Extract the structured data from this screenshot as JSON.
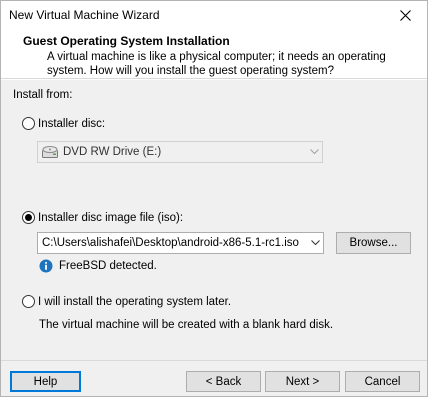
{
  "window": {
    "title": "New Virtual Machine Wizard"
  },
  "header": {
    "title": "Guest Operating System Installation",
    "description": "A virtual machine is like a physical computer; it needs an operating system. How will you install the guest operating system?"
  },
  "install_from": {
    "label": "Install from:",
    "options": {
      "disc": {
        "label": "Installer disc:",
        "checked": false,
        "drive": "DVD RW Drive (E:)"
      },
      "iso": {
        "label": "Installer disc image file (iso):",
        "checked": true,
        "path": "C:\\Users\\alishafei\\Desktop\\android-x86-5.1-rc1.iso",
        "browse_label": "Browse...",
        "detected": "FreeBSD detected."
      },
      "later": {
        "label": "I will install the operating system later.",
        "checked": false,
        "note": "The virtual machine will be created with a blank hard disk."
      }
    }
  },
  "footer": {
    "help": "Help",
    "back": "< Back",
    "next": "Next >",
    "cancel": "Cancel"
  },
  "colors": {
    "accent": "#0078d7",
    "info_icon": "#1e73be"
  }
}
